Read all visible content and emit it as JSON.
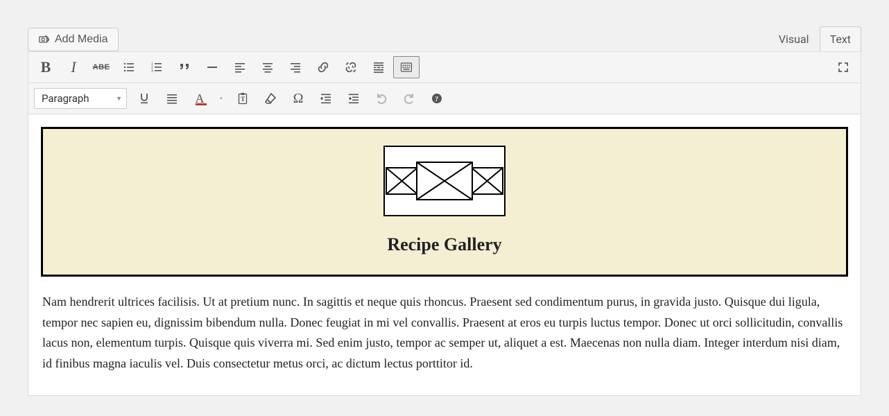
{
  "addMediaLabel": "Add Media",
  "tabs": {
    "visual": "Visual",
    "text": "Text"
  },
  "formatSelect": "Paragraph",
  "icons": {
    "bold": "B",
    "italic": "I",
    "strike": "ABE"
  },
  "galleryTitle": "Recipe Gallery",
  "bodyText": "Nam hendrerit ultrices facilisis. Ut at pretium nunc. In sagittis et neque quis rhoncus. Praesent sed condimentum purus, in gravida justo. Quisque dui ligula, tempor nec sapien eu, dignissim bibendum nulla. Donec feugiat in mi vel convallis. Praesent at eros eu turpis luctus tempor. Donec ut orci sollicitudin, convallis lacus non, elementum turpis. Quisque quis viverra mi. Sed enim justo, tempor ac semper ut, aliquet a est. Maecenas non nulla diam. Integer interdum nisi diam, id finibus magna iaculis vel. Duis consectetur metus orci, ac dictum lectus porttitor id."
}
